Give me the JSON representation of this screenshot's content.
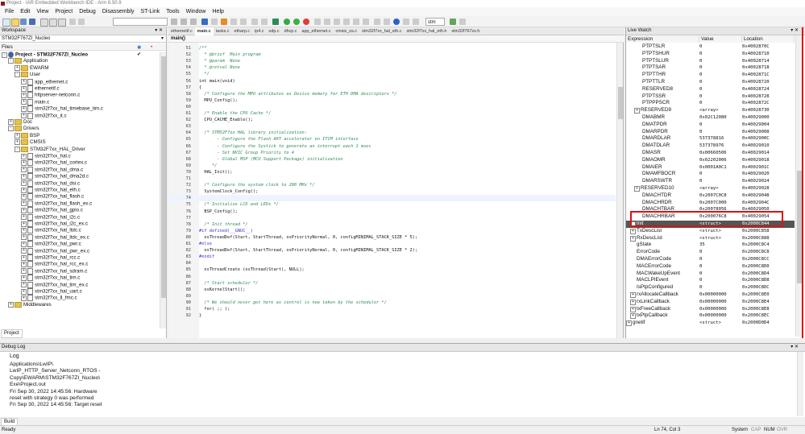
{
  "window": {
    "title": "Project - IAR Embedded Workbench IDE - Arm 8.50.9"
  },
  "menu": [
    "File",
    "Edit",
    "View",
    "Project",
    "Debug",
    "Disassembly",
    "ST-Link",
    "Tools",
    "Window",
    "Help"
  ],
  "toolbar": {
    "search_value": "stm",
    "search_button": "sum"
  },
  "workspace": {
    "header": "Workspace",
    "config": "STM32F767ZI_Nucleo",
    "files_label": "Files",
    "bottom_tab": "Project",
    "tree": [
      {
        "label": "Project - STM32F767ZI_Nucleo",
        "level": 0,
        "type": "project",
        "exp": "-",
        "check": true
      },
      {
        "label": "Application",
        "level": 1,
        "type": "folder",
        "exp": "-"
      },
      {
        "label": "EWARM",
        "level": 2,
        "type": "folder",
        "exp": "+"
      },
      {
        "label": "User",
        "level": 2,
        "type": "folder",
        "exp": "-"
      },
      {
        "label": "app_ethernet.c",
        "level": 3,
        "type": "file",
        "exp": "+"
      },
      {
        "label": "ethernetif.c",
        "level": 3,
        "type": "file",
        "exp": "+"
      },
      {
        "label": "httpserver-netconn.c",
        "level": 3,
        "type": "file",
        "exp": "+"
      },
      {
        "label": "main.c",
        "level": 3,
        "type": "file",
        "exp": "+"
      },
      {
        "label": "stm32f7xx_hal_timebase_tim.c",
        "level": 3,
        "type": "file",
        "exp": "+"
      },
      {
        "label": "stm32f7xx_it.c",
        "level": 3,
        "type": "file",
        "exp": "+"
      },
      {
        "label": "Doc",
        "level": 1,
        "type": "folder",
        "exp": "+"
      },
      {
        "label": "Drivers",
        "level": 1,
        "type": "folder",
        "exp": "-"
      },
      {
        "label": "BSP",
        "level": 2,
        "type": "folder",
        "exp": "+"
      },
      {
        "label": "CMSIS",
        "level": 2,
        "type": "folder",
        "exp": "+"
      },
      {
        "label": "STM32F7xx_HAL_Driver",
        "level": 2,
        "type": "folder",
        "exp": "-"
      },
      {
        "label": "stm32f7xx_hal.c",
        "level": 3,
        "type": "file",
        "exp": "+"
      },
      {
        "label": "stm32f7xx_hal_cortex.c",
        "level": 3,
        "type": "file",
        "exp": "+"
      },
      {
        "label": "stm32f7xx_hal_dma.c",
        "level": 3,
        "type": "file",
        "exp": "+"
      },
      {
        "label": "stm32f7xx_hal_dma2d.c",
        "level": 3,
        "type": "file",
        "exp": "+"
      },
      {
        "label": "stm32f7xx_hal_dsi.c",
        "level": 3,
        "type": "file",
        "exp": "+"
      },
      {
        "label": "stm32f7xx_hal_eth.c",
        "level": 3,
        "type": "file",
        "exp": "+"
      },
      {
        "label": "stm32f7xx_hal_flash.c",
        "level": 3,
        "type": "file",
        "exp": "+"
      },
      {
        "label": "stm32f7xx_hal_flash_ex.c",
        "level": 3,
        "type": "file",
        "exp": "+"
      },
      {
        "label": "stm32f7xx_hal_gpio.c",
        "level": 3,
        "type": "file",
        "exp": "+"
      },
      {
        "label": "stm32f7xx_hal_i2c.c",
        "level": 3,
        "type": "file",
        "exp": "+"
      },
      {
        "label": "stm32f7xx_hal_i2c_ex.c",
        "level": 3,
        "type": "file",
        "exp": "+"
      },
      {
        "label": "stm32f7xx_hal_ltdc.c",
        "level": 3,
        "type": "file",
        "exp": "+"
      },
      {
        "label": "stm32f7xx_hal_ltdc_ex.c",
        "level": 3,
        "type": "file",
        "exp": "+"
      },
      {
        "label": "stm32f7xx_hal_pwr.c",
        "level": 3,
        "type": "file",
        "exp": "+"
      },
      {
        "label": "stm32f7xx_hal_pwr_ex.c",
        "level": 3,
        "type": "file",
        "exp": "+"
      },
      {
        "label": "stm32f7xx_hal_rcc.c",
        "level": 3,
        "type": "file",
        "exp": "+"
      },
      {
        "label": "stm32f7xx_hal_rcc_ex.c",
        "level": 3,
        "type": "file",
        "exp": "+"
      },
      {
        "label": "stm32f7xx_hal_sdram.c",
        "level": 3,
        "type": "file",
        "exp": "+"
      },
      {
        "label": "stm32f7xx_hal_tim.c",
        "level": 3,
        "type": "file",
        "exp": "+"
      },
      {
        "label": "stm32f7xx_hal_tim_ex.c",
        "level": 3,
        "type": "file",
        "exp": "+"
      },
      {
        "label": "stm32f7xx_hal_uart.c",
        "level": 3,
        "type": "file",
        "exp": "+"
      },
      {
        "label": "stm32f7xx_ll_fmc.c",
        "level": 3,
        "type": "file",
        "exp": "+"
      },
      {
        "label": "Middlewares",
        "level": 1,
        "type": "folder",
        "exp": "+"
      }
    ]
  },
  "editor": {
    "tabs": [
      "ethernetif.c",
      "main.c",
      "tasks.c",
      "etharp.c",
      "ip4.c",
      "udp.c",
      "dhcp.c",
      "app_ethernet.c",
      "cmsis_os.c",
      "stm32f7xx_hal_eth.c",
      "stm32f7xx_hal_eth.h",
      "stm32f767xx.h"
    ],
    "active_tab": "main.c",
    "function": "main()",
    "lines": [
      {
        "n": "51",
        "t": "/**",
        "c": "comment"
      },
      {
        "n": "52",
        "t": "  * @brief  Main program",
        "c": "comment"
      },
      {
        "n": "53",
        "t": "  * @param  None",
        "c": "comment"
      },
      {
        "n": "54",
        "t": "  * @retval None",
        "c": "comment"
      },
      {
        "n": "55",
        "t": "  */",
        "c": "comment"
      },
      {
        "n": "56",
        "t": "int main(void)",
        "c": "code"
      },
      {
        "n": "57",
        "t": "{",
        "c": "code"
      },
      {
        "n": "58",
        "t": "  /* Configure the MPU attributes as Device memory for ETH DMA descriptors */",
        "c": "comment"
      },
      {
        "n": "59",
        "t": "  MPU_Config();",
        "c": "code"
      },
      {
        "n": "60",
        "t": "",
        "c": "code"
      },
      {
        "n": "61",
        "t": "  /* Enable the CPU Cache */",
        "c": "comment"
      },
      {
        "n": "62",
        "t": "  CPU_CACHE_Enable();",
        "c": "code"
      },
      {
        "n": "63",
        "t": "",
        "c": "code"
      },
      {
        "n": "64",
        "t": "  /* STM32F7xx HAL library initialization:",
        "c": "comment"
      },
      {
        "n": "65",
        "t": "       - Configure the Flash ART accelerator on ITCM interface",
        "c": "comment"
      },
      {
        "n": "66",
        "t": "       - Configure the Systick to generate an interrupt each 1 msec",
        "c": "comment"
      },
      {
        "n": "67",
        "t": "       - Set NVIC Group Priority to 4",
        "c": "comment"
      },
      {
        "n": "68",
        "t": "       - Global MSP (MCU Support Package) initialization",
        "c": "comment"
      },
      {
        "n": "69",
        "t": "     */",
        "c": "comment"
      },
      {
        "n": "70",
        "t": "  HAL_Init();",
        "c": "code"
      },
      {
        "n": "71",
        "t": "",
        "c": "code"
      },
      {
        "n": "72",
        "t": "  /* Configure the system clock to 200 MHz */",
        "c": "comment"
      },
      {
        "n": "73",
        "t": "  SystemClock_Config();",
        "c": "code"
      },
      {
        "n": "74",
        "t": "",
        "c": "current"
      },
      {
        "n": "75",
        "t": "  /* Initialize LCD and LEDs */",
        "c": "comment"
      },
      {
        "n": "76",
        "t": "  BSP_Config();",
        "c": "code"
      },
      {
        "n": "77",
        "t": "",
        "c": "code"
      },
      {
        "n": "78",
        "t": "  /* Init thread */",
        "c": "comment"
      },
      {
        "n": "79",
        "t": "#if defined(__GNUC__)",
        "c": "pre"
      },
      {
        "n": "80",
        "t": "  osThreadDef(Start, StartThread, osPriorityNormal, 0, configMINIMAL_STACK_SIZE * 5);",
        "c": "code"
      },
      {
        "n": "81",
        "t": "#else",
        "c": "pre"
      },
      {
        "n": "82",
        "t": "  osThreadDef(Start, StartThread, osPriorityNormal, 0, configMINIMAL_STACK_SIZE * 2);",
        "c": "code"
      },
      {
        "n": "83",
        "t": "#endif",
        "c": "pre"
      },
      {
        "n": "84",
        "t": "",
        "c": "code"
      },
      {
        "n": "85",
        "t": "  osThreadCreate (osThread(Start), NULL);",
        "c": "code"
      },
      {
        "n": "86",
        "t": "",
        "c": "code"
      },
      {
        "n": "87",
        "t": "  /* Start scheduler */",
        "c": "comment"
      },
      {
        "n": "88",
        "t": "  osKernelStart();",
        "c": "code"
      },
      {
        "n": "89",
        "t": "",
        "c": "code"
      },
      {
        "n": "90",
        "t": "  /* We should never get here as control is now taken by the scheduler */",
        "c": "comment"
      },
      {
        "n": "91",
        "t": "  for( ;; );",
        "c": "code"
      },
      {
        "n": "92",
        "t": "}",
        "c": "code"
      }
    ]
  },
  "live_watch": {
    "header": "Live Watch",
    "columns": [
      "Expression",
      "Value",
      "Location"
    ],
    "rows": [
      {
        "e": "PTPTSLR",
        "v": "0",
        "l": "0x4002870C",
        "i": 2
      },
      {
        "e": "PTPTSHUR",
        "v": "0",
        "l": "0x40028710",
        "i": 2
      },
      {
        "e": "PTPTSLUR",
        "v": "0",
        "l": "0x40028714",
        "i": 2
      },
      {
        "e": "PTPTSAR",
        "v": "0",
        "l": "0x40028718",
        "i": 2
      },
      {
        "e": "PTPTTHR",
        "v": "0",
        "l": "0x4002871C",
        "i": 2
      },
      {
        "e": "PTPTTLR",
        "v": "0",
        "l": "0x40028720",
        "i": 2
      },
      {
        "e": "RESERVED8",
        "v": "0",
        "l": "0x40028724",
        "i": 2
      },
      {
        "e": "PTPTSSR",
        "v": "0",
        "l": "0x40028728",
        "i": 2
      },
      {
        "e": "PTPPPSCR",
        "v": "0",
        "l": "0x4002872C",
        "i": 2
      },
      {
        "e": "RESERVED9",
        "v": "<array>",
        "l": "0x40028730",
        "i": 1,
        "x": "+"
      },
      {
        "e": "DMABMR",
        "v": "0x02C12080",
        "l": "0x40029000",
        "i": 2
      },
      {
        "e": "DMATPDR",
        "v": "0",
        "l": "0x40029004",
        "i": 2
      },
      {
        "e": "DMARPDR",
        "v": "0",
        "l": "0x40029008",
        "i": 2
      },
      {
        "e": "DMARDLAR",
        "v": "537378816",
        "l": "0x4002900C",
        "i": 2
      },
      {
        "e": "DMATDLAR",
        "v": "537378976",
        "l": "0x40029010",
        "i": 2
      },
      {
        "e": "DMASR",
        "v": "0x00660506",
        "l": "0x40029014",
        "i": 2
      },
      {
        "e": "DMAOMR",
        "v": "0x02202006",
        "l": "0x40029018",
        "i": 2
      },
      {
        "e": "DMAIER",
        "v": "0x0001A0C1",
        "l": "0x4002901C",
        "i": 2
      },
      {
        "e": "DMAMFBOCR",
        "v": "0",
        "l": "0x40029020",
        "i": 2
      },
      {
        "e": "DMARSWTR",
        "v": "0",
        "l": "0x40029024",
        "i": 2
      },
      {
        "e": "RESERVED10",
        "v": "<array>",
        "l": "0x40029028",
        "i": 1,
        "x": "+"
      },
      {
        "e": "DMACHTDR",
        "v": "0x2007C0C8",
        "l": "0x40029048",
        "i": 2
      },
      {
        "e": "DMACHRDR",
        "v": "0x2007C000",
        "l": "0x4002904C",
        "i": 2
      },
      {
        "e": "DMACHTBAR",
        "v": "0x20078056",
        "l": "0x40029050",
        "i": 2
      },
      {
        "e": "DMACHRBAR",
        "v": "0x200076C8",
        "l": "0x40029054",
        "i": 2
      },
      {
        "e": "Init",
        "v": "<struct>",
        "l": "0x2000C844",
        "i": 0,
        "x": "+",
        "sel": true
      },
      {
        "e": "TxDescList",
        "v": "<struct>",
        "l": "0x2000C858",
        "i": 0,
        "x": "+"
      },
      {
        "e": "RxDescList",
        "v": "<struct>",
        "l": "0x2000C888",
        "i": 0,
        "x": "+"
      },
      {
        "e": "gState",
        "v": "35",
        "l": "0x2000C8C4",
        "i": 1
      },
      {
        "e": "ErrorCode",
        "v": "0",
        "l": "0x2000C8C8",
        "i": 1
      },
      {
        "e": "DMAErrorCode",
        "v": "0",
        "l": "0x2000C8CC",
        "i": 1
      },
      {
        "e": "MACErrorCode",
        "v": "0",
        "l": "0x2000C8D0",
        "i": 1
      },
      {
        "e": "MACWakeUpEvent",
        "v": "0",
        "l": "0x2000C8D4",
        "i": 1
      },
      {
        "e": "MACLPIEvent",
        "v": "0",
        "l": "0x2000C8D8",
        "i": 1
      },
      {
        "e": "IsPtpConfigured",
        "v": "0",
        "l": "0x2000C8DC",
        "i": 1
      },
      {
        "e": "rxAllocateCallback",
        "v": "0x00000000",
        "l": "0x2000C8E0",
        "i": 0,
        "x": "+"
      },
      {
        "e": "rxLinkCallback",
        "v": "0x00000000",
        "l": "0x2000C8E4",
        "i": 0,
        "x": "+"
      },
      {
        "e": "txFreeCallback",
        "v": "0x00000000",
        "l": "0x2000C8E8",
        "i": 0,
        "x": "+"
      },
      {
        "e": "txPtpCallback",
        "v": "0x00000000",
        "l": "0x2000C8EC",
        "i": 0,
        "x": "+"
      },
      {
        "e": "gnetif",
        "v": "<struct>",
        "l": "0x2000D0D4",
        "i": -1,
        "x": "+"
      }
    ]
  },
  "debug_log": {
    "header": "Debug Log",
    "column": "Log",
    "lines": [
      "Applications\\LwIP\\",
      "LwIP_HTTP_Server_Netconn_RTOS -",
      "Copy\\EWARM\\STM32F767ZI_Nucleo\\",
      "Exe\\Project.out",
      "Fri Sep 30, 2022 14:45:56: Hardware",
      "reset with strategy 0 was performed",
      "Fri Sep 30, 2022 14:45:56: Target reset"
    ],
    "bottom_tab": "Build"
  },
  "status": {
    "left": "Ready",
    "position": "Ln 74, Col 3",
    "system": "System",
    "caps": "CAP",
    "num": "NUM",
    "ovr": "OVR"
  },
  "colors": {
    "comment": "#2e8b57",
    "preprocessor": "#3b2fd4",
    "highlight": "#dd1111"
  }
}
